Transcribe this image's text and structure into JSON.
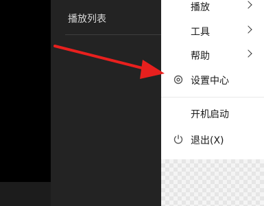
{
  "panel": {
    "playlist_title": "播放列表"
  },
  "menu": {
    "items": [
      {
        "label": "播放",
        "has_submenu": true
      },
      {
        "label": "工具",
        "has_submenu": true
      },
      {
        "label": "帮助",
        "has_submenu": true
      },
      {
        "label": "设置中心",
        "icon": "gear-icon"
      },
      {
        "label": "开机启动"
      },
      {
        "label": "退出(X)",
        "icon": "power-icon"
      }
    ]
  },
  "colors": {
    "arrow": "#e8201e",
    "menu_bg": "#ffffff",
    "panel_bg": "#232323"
  }
}
